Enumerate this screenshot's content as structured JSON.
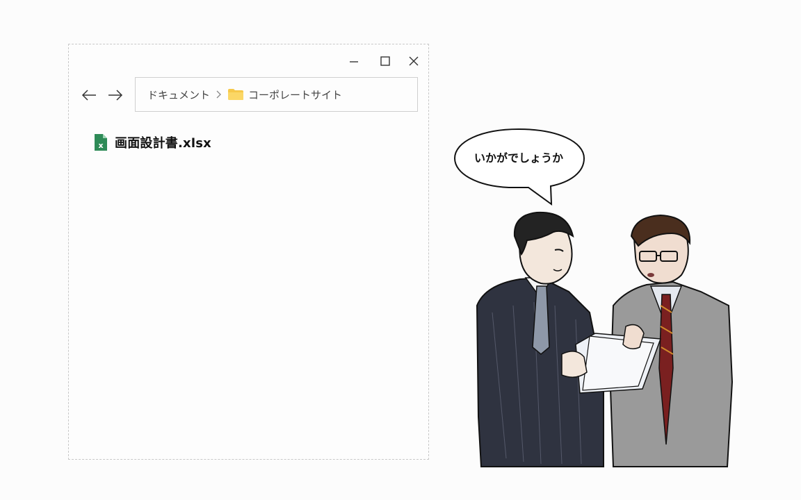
{
  "window": {
    "controls": {
      "minimize": "minimize-icon",
      "maximize": "maximize-icon",
      "close": "close-icon"
    },
    "nav": {
      "back": "arrow-left-icon",
      "forward": "arrow-right-icon"
    },
    "breadcrumb": {
      "root": "ドキュメント",
      "separator_icon": "chevron-right-icon",
      "folder_icon": "folder-icon",
      "folder": "コーポレートサイト"
    },
    "files": [
      {
        "name": "画面設計書.xlsx",
        "icon": "excel-file-icon",
        "icon_color": "#2e8b57"
      }
    ]
  },
  "speech_bubble": {
    "text": "いかがでしょうか"
  },
  "colors": {
    "folder": "#f6c94a",
    "excel": "#2e8b57"
  }
}
